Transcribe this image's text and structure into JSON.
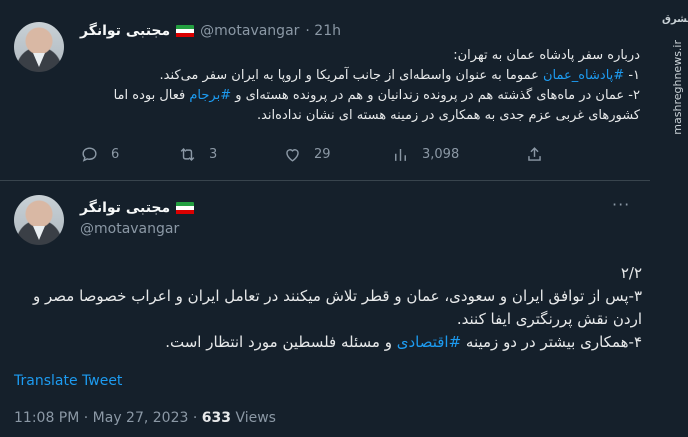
{
  "tweet1": {
    "display_name": "مجتبی توانگر",
    "handle": "@motavangar",
    "time": "· 21h",
    "body_line1": "درباره سفر پادشاه عمان به تهران:",
    "body_line2_prefix": "۱- ",
    "body_line2_hashtag": "#پادشاه_عمان",
    "body_line2_rest": " عموما به عنوان واسطه‌ای از جانب آمریکا و اروپا به ایران سفر می‌کند.",
    "body_line3_prefix": "۲- عمان در ماه‌های گذشته هم در پرونده زندانیان و هم در پرونده هسته‌ای و ",
    "body_line3_hashtag": "#برجام",
    "body_line3_rest": " فعال بوده اما",
    "body_line4": "کشورهای غربی عزم جدی به همکاری در زمینه هسته ای نشان نداده‌اند.",
    "actions": {
      "replies": "6",
      "retweets": "3",
      "likes": "29",
      "views": "3,098"
    }
  },
  "tweet2": {
    "display_name": "مجتبی توانگر",
    "handle": "@motavangar",
    "body_line1": "۲/۲",
    "body_line2": "۳-پس از توافق ایران و سعودی، عمان و قطر تلاش میکنند در تعامل ایران و اعراب خصوصا مصر و",
    "body_line3": "اردن نقش پررنگتری ایفا کنند.",
    "body_line4_prefix": "۴-همکاری بیشتر در دو زمینه ",
    "body_line4_hashtag": "#اقتصادی",
    "body_line4_rest": " و مسئله فلسطین مورد انتظار است.",
    "translate_label": "Translate Tweet",
    "timestamp": "11:08 PM · May 27, 2023 · ",
    "views_count": "633",
    "views_label": " Views"
  },
  "watermark": {
    "logo": "مشرق",
    "site": "mashreghnews.ir"
  },
  "colors": {
    "background": "#15202b",
    "link": "#1d9bf0",
    "muted": "#8b98a5"
  }
}
